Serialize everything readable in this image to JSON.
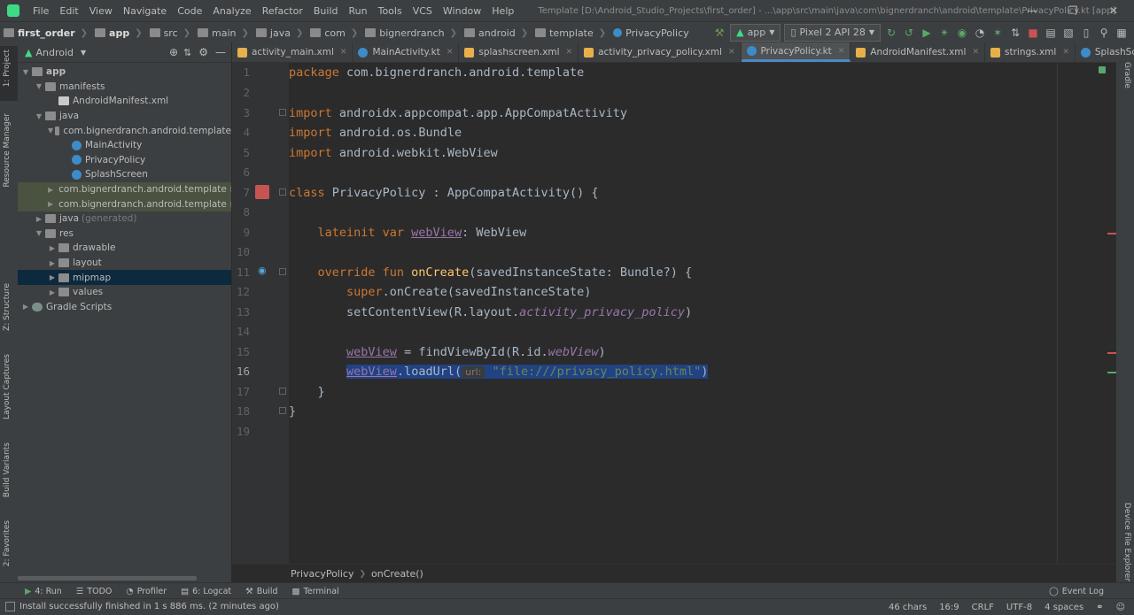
{
  "menu": [
    "File",
    "Edit",
    "View",
    "Navigate",
    "Code",
    "Analyze",
    "Refactor",
    "Build",
    "Run",
    "Tools",
    "VCS",
    "Window",
    "Help"
  ],
  "window_title": "Template [D:\\Android_Studio_Projects\\first_order] - ...\\app\\src\\main\\java\\com\\bignerdranch\\android\\template\\PrivacyPolicy.kt [app]",
  "breadcrumbs": [
    "first_order",
    "app",
    "src",
    "main",
    "java",
    "com",
    "bignerdranch",
    "android",
    "template",
    "PrivacyPolicy"
  ],
  "run_config": "app",
  "device": "Pixel 2 API 28",
  "left_tools": [
    "1: Project",
    "Resource Manager",
    "Z: Structure",
    "Layout Captures",
    "Build Variants",
    "2: Favorites"
  ],
  "right_tools": [
    "Gradle",
    "Device File Explorer"
  ],
  "project_view": "Android",
  "tree": [
    {
      "label": "app",
      "depth": 0,
      "icon": "app",
      "open": true
    },
    {
      "label": "manifests",
      "depth": 1,
      "icon": "folder",
      "open": true
    },
    {
      "label": "AndroidManifest.xml",
      "depth": 2,
      "icon": "file"
    },
    {
      "label": "java",
      "depth": 1,
      "icon": "folder",
      "open": true
    },
    {
      "label": "com.bignerdranch.android.template",
      "depth": 2,
      "icon": "folder",
      "open": true
    },
    {
      "label": "MainActivity",
      "depth": 3,
      "icon": "kt"
    },
    {
      "label": "PrivacyPolicy",
      "depth": 3,
      "icon": "kt"
    },
    {
      "label": "SplashScreen",
      "depth": 3,
      "icon": "kt"
    },
    {
      "label": "com.bignerdranch.android.template",
      "suffix": "(and",
      "depth": 2,
      "icon": "folder",
      "open": false,
      "hl": "grn"
    },
    {
      "label": "com.bignerdranch.android.template",
      "suffix": "(test",
      "depth": 2,
      "icon": "folder",
      "open": false,
      "hl": "grn"
    },
    {
      "label": "java",
      "suffix": "(generated)",
      "depth": 1,
      "icon": "folder",
      "open": false
    },
    {
      "label": "res",
      "depth": 1,
      "icon": "folder",
      "open": true
    },
    {
      "label": "drawable",
      "depth": 2,
      "icon": "folder",
      "open": false
    },
    {
      "label": "layout",
      "depth": 2,
      "icon": "folder",
      "open": false
    },
    {
      "label": "mipmap",
      "depth": 2,
      "icon": "folder",
      "open": false,
      "hl": "sel"
    },
    {
      "label": "values",
      "depth": 2,
      "icon": "folder",
      "open": false
    },
    {
      "label": "Gradle Scripts",
      "depth": 0,
      "icon": "gradle",
      "open": false
    }
  ],
  "tabs": [
    {
      "label": "activity_main.xml",
      "color": "#e8b04a"
    },
    {
      "label": "MainActivity.kt",
      "color": "#3d8cc9"
    },
    {
      "label": "splashscreen.xml",
      "color": "#e8b04a"
    },
    {
      "label": "activity_privacy_policy.xml",
      "color": "#e8b04a"
    },
    {
      "label": "PrivacyPolicy.kt",
      "color": "#3d8cc9",
      "active": true
    },
    {
      "label": "AndroidManifest.xml",
      "color": "#e8b04a"
    },
    {
      "label": "strings.xml",
      "color": "#e8b04a"
    },
    {
      "label": "SplashScreen.kt",
      "color": "#3d8cc9"
    }
  ],
  "code": {
    "l1_kw": "package",
    "l1_rest": " com.bignerdranch.android.template",
    "l3_kw": "import",
    "l3_rest": " androidx.appcompat.app.AppCompatActivity",
    "l4_kw": "import",
    "l4_rest": " android.os.Bundle",
    "l5_kw": "import",
    "l5_rest": " android.webkit.WebView",
    "l7_kw": "class",
    "l7_rest": " PrivacyPolicy : AppCompatActivity() {",
    "l9_kw": "    lateinit var ",
    "l9_prop": "webView",
    "l9_rest": ": WebView",
    "l11_kw": "    override fun ",
    "l11_fn": "onCreate",
    "l11_rest": "(savedInstanceState: Bundle?) {",
    "l12_kw": "        super",
    "l12_rest": ".onCreate(savedInstanceState)",
    "l13_a": "        setContentView(R.layout.",
    "l13_it": "activity_privacy_policy",
    "l13_b": ")",
    "l15_pre": "        ",
    "l15_prop": "webView",
    "l15_mid": " = findViewById(R.id.",
    "l15_it": "webView",
    "l15_end": ")",
    "l16_pre": "        ",
    "l16_prop": "webView",
    "l16_mid": ".loadUrl(",
    "l16_hint": "url:",
    "l16_str": "\"file:///privacy_policy.html\"",
    "l16_end": ")",
    "l17": "    }",
    "l18": "}"
  },
  "editor_crumbs": [
    "PrivacyPolicy",
    "onCreate()"
  ],
  "toolwindows": [
    "4: Run",
    "TODO",
    "Profiler",
    "6: Logcat",
    "Build",
    "Terminal"
  ],
  "event_log": "Event Log",
  "status": {
    "message": "Install successfully finished in 1 s 886 ms. (2 minutes ago)",
    "chars": "46 chars",
    "pos": "16:9",
    "eol": "CRLF",
    "enc": "UTF-8",
    "indent": "4 spaces"
  }
}
